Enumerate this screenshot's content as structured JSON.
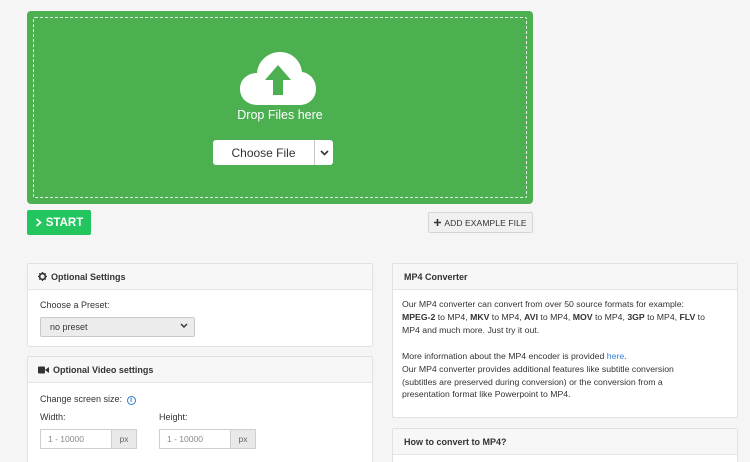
{
  "dropzone": {
    "drop_text": "Drop Files here",
    "choose_label": "Choose File"
  },
  "actions": {
    "start_label": "START",
    "example_label": "ADD EXAMPLE FILE"
  },
  "settings": {
    "title": "Optional Settings",
    "preset_label": "Choose a Preset:",
    "preset_value": "no preset"
  },
  "video": {
    "title": "Optional Video settings",
    "screen_size_label": "Change screen size:",
    "width_label": "Width:",
    "height_label": "Height:",
    "width_placeholder": "1 - 10000",
    "height_placeholder": "1 - 10000",
    "unit": "px"
  },
  "mp4": {
    "title": "MP4 Converter",
    "p1_a": "Our MP4 converter can convert from over 50 source formats for example:",
    "fmt_1": "MPEG-2",
    "to_1": " to MP4, ",
    "fmt_2": "MKV",
    "to_2": " to MP4, ",
    "fmt_3": "AVI",
    "to_3": " to MP4, ",
    "fmt_4": "MOV",
    "to_4": " to MP4, ",
    "fmt_5": "3GP",
    "to_5": " to MP4, ",
    "fmt_6": "FLV",
    "to_6": " to",
    "p1_end": "MP4 and much more. Just try it out.",
    "p2_text": "More information about the MP4 encoder is provided ",
    "p2_link": "here",
    "p2_end": ".",
    "p3_l1": "Our MP4 converter provides additional features like subtitle conversion",
    "p3_l2": "(subtitles are preserved during conversion) or the conversion from a",
    "p3_l3": "presentation format like Powerpoint to MP4."
  },
  "how": {
    "title": "How to convert to MP4?"
  },
  "colors": {
    "dropzone": "#4caf50",
    "start": "#22c55e",
    "link": "#2d7fd6"
  }
}
